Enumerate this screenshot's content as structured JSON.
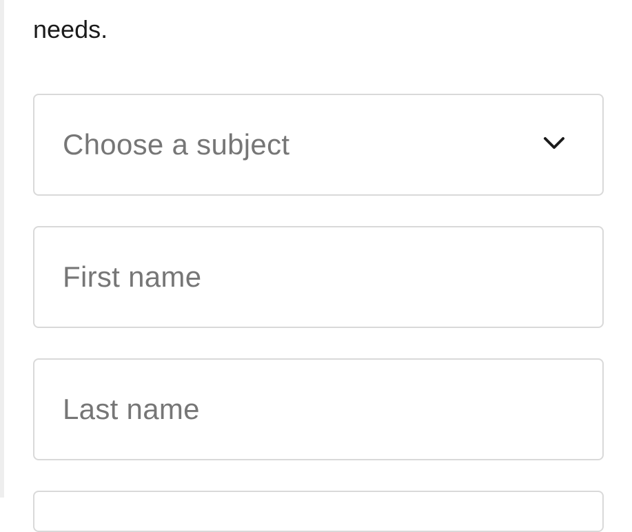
{
  "intro": {
    "partial_line": "",
    "last_line": "needs."
  },
  "form": {
    "subject_select": {
      "placeholder": "Choose a subject",
      "icon": "chevron-down-icon"
    },
    "first_name": {
      "placeholder": "First name"
    },
    "last_name": {
      "placeholder": "Last name"
    }
  },
  "colors": {
    "text": "#1b1b1b",
    "placeholder": "#767676",
    "border": "#d9d9d9",
    "left_edge": "#eeeeee"
  }
}
